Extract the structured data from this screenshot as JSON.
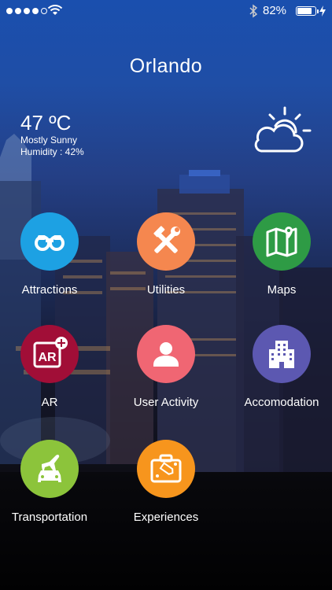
{
  "status_bar": {
    "battery_text": "82%",
    "battery_level": 0.82,
    "signal_bars_filled": 4,
    "signal_bars_total": 5
  },
  "header": {
    "title": "Orlando"
  },
  "weather": {
    "temperature": "47 ºC",
    "condition": "Mostly Sunny",
    "humidity": "Humidity : 42%",
    "icon": "partly-cloudy-icon"
  },
  "menu": {
    "items": [
      {
        "label": "Attractions",
        "icon": "binoculars-icon",
        "color": "#1da1e3"
      },
      {
        "label": "Utilities",
        "icon": "tools-icon",
        "color": "#f5874f"
      },
      {
        "label": "Maps",
        "icon": "map-icon",
        "color": "#2e9b45"
      },
      {
        "label": "AR",
        "icon": "ar-plus-icon",
        "color": "#a10e37"
      },
      {
        "label": "User Activity",
        "icon": "user-icon",
        "color": "#f06673"
      },
      {
        "label": "Accomodation",
        "icon": "building-icon",
        "color": "#5c58b1"
      },
      {
        "label": "Transportation",
        "icon": "plane-car-icon",
        "color": "#8cc43b"
      },
      {
        "label": "Experiences",
        "icon": "suitcase-icon",
        "color": "#f7951d"
      }
    ]
  }
}
